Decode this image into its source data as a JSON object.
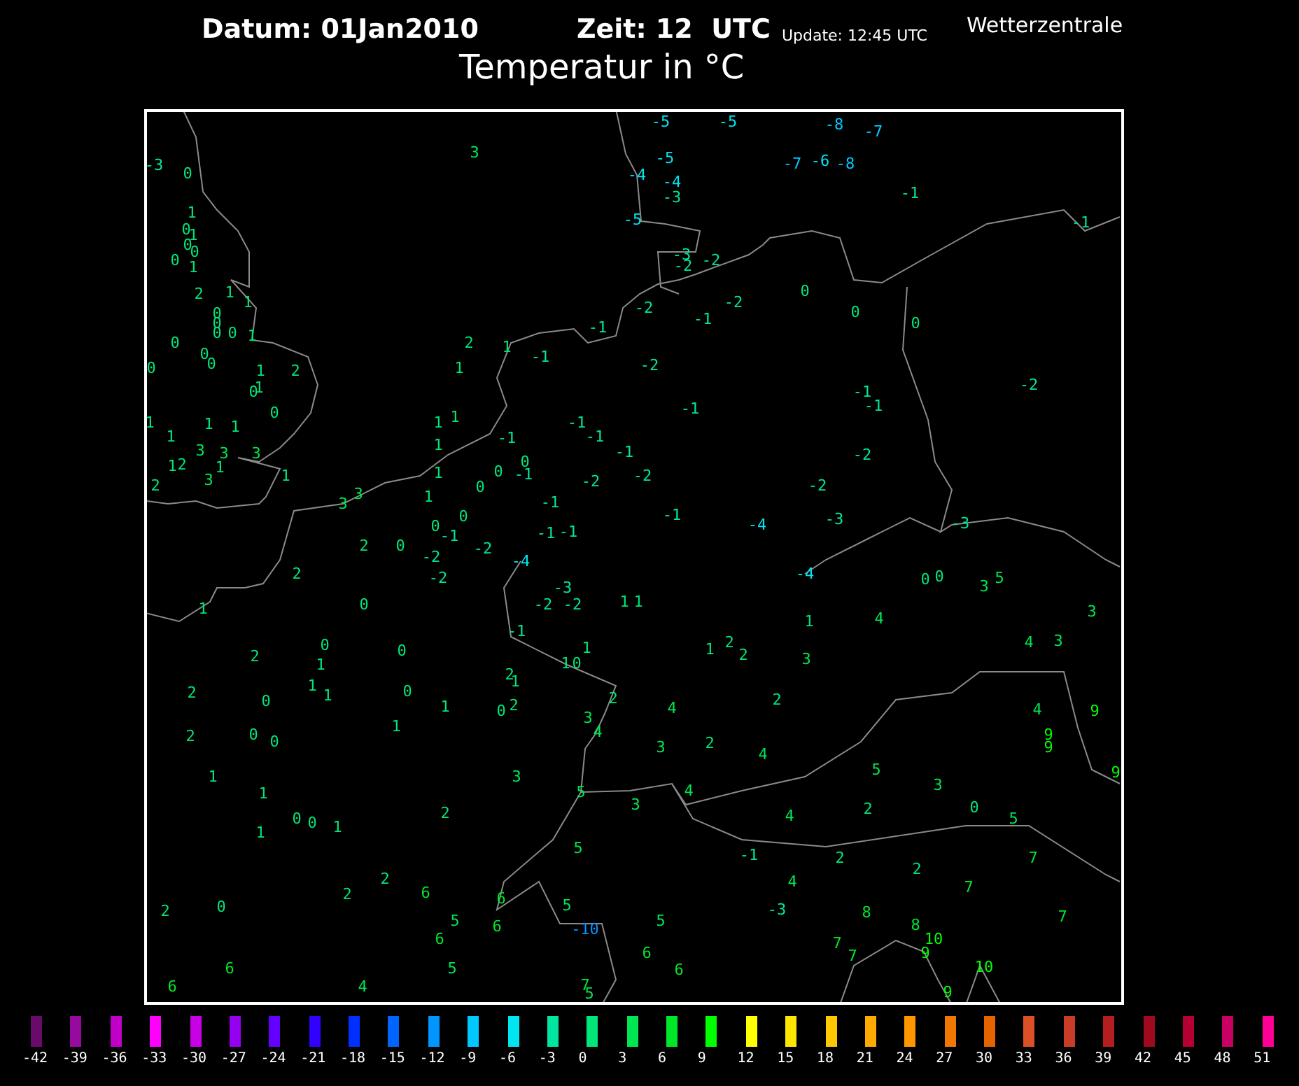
{
  "header": {
    "date": "Datum: 01Jan2010",
    "time": "Zeit: 12  UTC",
    "update": "Update: 12:45 UTC",
    "source": "Wetterzentrale",
    "title": "Temperatur in °C"
  },
  "stations": [
    "-3",
    "0",
    "3",
    "1",
    "0",
    "1",
    "0",
    "0",
    "0",
    "1",
    "2",
    "1",
    "1",
    "0",
    "0",
    "0",
    "0",
    "1",
    "0",
    "0",
    "0",
    "0",
    "1",
    "2",
    "0",
    "1",
    "0",
    "1",
    "1",
    "1",
    "1",
    "3",
    "3",
    "3",
    "1",
    "2",
    "1",
    "3",
    "1",
    "2",
    "3",
    "3",
    "2",
    "1",
    "-1",
    "-1",
    "1",
    "1",
    "1",
    "1",
    "-1",
    "-1",
    "-1",
    "-1",
    "1",
    "0",
    "0",
    "0",
    "-1",
    "-2",
    "-1",
    "1",
    "0",
    "0",
    "-1",
    "0",
    "-1",
    "-1",
    "2",
    "-2",
    "-2",
    "-2",
    "-4",
    "2",
    "1",
    "0",
    "-3",
    "-2",
    "-2",
    "1",
    "1",
    "-1",
    "2",
    "0",
    "1",
    "0",
    "1",
    "1",
    "0",
    "2",
    "1",
    "2",
    "0",
    "1",
    "1",
    "0",
    "1",
    "0",
    "2",
    "2",
    "3",
    "2",
    "0",
    "0",
    "1",
    "4",
    "1",
    "3",
    "2",
    "1",
    "5",
    "3",
    "0",
    "0",
    "1",
    "1",
    "5",
    "2",
    "2",
    "6",
    "6",
    "2",
    "0",
    "5",
    "5",
    "6",
    "-10",
    "5",
    "6",
    "6",
    "6",
    "5",
    "6",
    "6",
    "4",
    "7",
    "5",
    "-5",
    "-5",
    "-8",
    "-7",
    "-5",
    "-7",
    "-6",
    "-8",
    "-4",
    "-4",
    "-3",
    "-1",
    "-5",
    "-1",
    "-3",
    "-2",
    "-2",
    "0",
    "-2",
    "-2",
    "-1",
    "0",
    "0",
    "-2",
    "-1",
    "-2",
    "-1",
    "-1",
    "-2",
    "-2",
    "-2",
    "-1",
    "-4",
    "-3",
    "-3",
    "-4",
    "0",
    "0",
    "3",
    "5",
    "1",
    "4",
    "3",
    "1",
    "2",
    "2",
    "3",
    "4",
    "3",
    "2",
    "4",
    "4",
    "9",
    "3",
    "2",
    "4",
    "9",
    "9",
    "5",
    "3",
    "0",
    "5",
    "9",
    "4",
    "2",
    "4",
    "-1",
    "2",
    "2",
    "7",
    "4",
    "7",
    "-3",
    "8",
    "8",
    "7",
    "7",
    "10",
    "7",
    "9",
    "10",
    "9"
  ],
  "legend": [
    {
      "label": "-42",
      "color": "#6a0a6a"
    },
    {
      "label": "-39",
      "color": "#960aa0"
    },
    {
      "label": "-36",
      "color": "#c000c8"
    },
    {
      "label": "-33",
      "color": "#ff00ff"
    },
    {
      "label": "-30",
      "color": "#c800e6"
    },
    {
      "label": "-27",
      "color": "#9600f0"
    },
    {
      "label": "-24",
      "color": "#6400ff"
    },
    {
      "label": "-21",
      "color": "#3200ff"
    },
    {
      "label": "-18",
      "color": "#0030ff"
    },
    {
      "label": "-15",
      "color": "#0064ff"
    },
    {
      "label": "-12",
      "color": "#0096ff"
    },
    {
      "label": "-9",
      "color": "#00c8ff"
    },
    {
      "label": "-6",
      "color": "#00e6f0"
    },
    {
      "label": "-3",
      "color": "#00e6a0"
    },
    {
      "label": "0",
      "color": "#00e678"
    },
    {
      "label": "3",
      "color": "#00e650"
    },
    {
      "label": "6",
      "color": "#00e628"
    },
    {
      "label": "9",
      "color": "#00ff00"
    },
    {
      "label": "12",
      "color": "#ffff00"
    },
    {
      "label": "15",
      "color": "#ffe600"
    },
    {
      "label": "18",
      "color": "#ffc800"
    },
    {
      "label": "21",
      "color": "#ffaa00"
    },
    {
      "label": "24",
      "color": "#ff9600"
    },
    {
      "label": "27",
      "color": "#f07800"
    },
    {
      "label": "30",
      "color": "#e66400"
    },
    {
      "label": "33",
      "color": "#dc5028"
    },
    {
      "label": "36",
      "color": "#c83c28"
    },
    {
      "label": "39",
      "color": "#b41e1e"
    },
    {
      "label": "42",
      "color": "#a00a1e"
    },
    {
      "label": "45",
      "color": "#b40032"
    },
    {
      "label": "48",
      "color": "#c80064"
    },
    {
      "label": "51",
      "color": "#ff0096"
    }
  ]
}
